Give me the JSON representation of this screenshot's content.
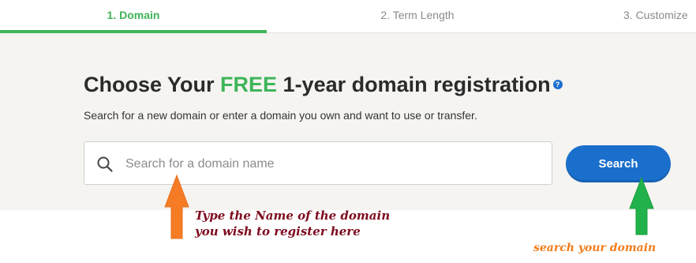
{
  "steps": [
    {
      "label": "1. Domain",
      "active": true
    },
    {
      "label": "2. Term Length",
      "active": false
    },
    {
      "label": "3. Customize",
      "active": false
    }
  ],
  "main": {
    "heading_part1": "Choose Your ",
    "heading_free": "FREE",
    "heading_part2": " 1-year domain registration",
    "help_icon": "?",
    "subtitle": "Search for a new domain or enter a domain you own and want to use or transfer.",
    "search": {
      "placeholder": "Search for a domain name",
      "value": "",
      "icon": "search-icon"
    },
    "search_button_label": "Search"
  },
  "annotations": {
    "note_input": "Type the Name of the domain you wish to register here",
    "note_button": "search your domain",
    "arrow_input_color": "#f57c25",
    "arrow_button_color": "#22b24c"
  },
  "colors": {
    "accent_green": "#3fb559",
    "button_blue": "#1b6fcc",
    "panel_bg": "#f5f4f1"
  }
}
